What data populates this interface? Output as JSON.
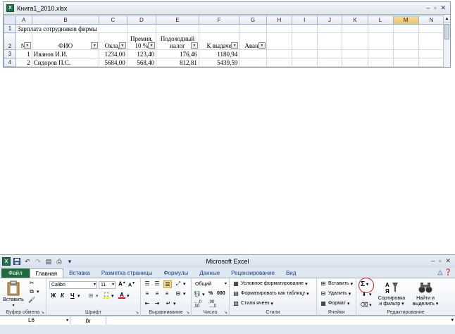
{
  "workbook": {
    "title": "Книга1_2010.xlsx",
    "window_controls": [
      "–",
      "▫",
      "✕"
    ],
    "columns": [
      "A",
      "B",
      "C",
      "D",
      "E",
      "F",
      "G",
      "H",
      "I",
      "J",
      "K",
      "L",
      "M",
      "N"
    ],
    "active_column": "M",
    "row_numbers": [
      "1",
      "2",
      "3",
      "4"
    ],
    "cells": {
      "r1_title": "Зарплата сотрудников фирмы",
      "h_num": "№",
      "h_fio": "ФИО",
      "h_oklad": "Оклад",
      "h_premia_1": "Премия,",
      "h_premia_2": "10 %",
      "h_nalog_1": "Подоходный",
      "h_nalog_2": "налог",
      "h_vydacha": "К выдаче",
      "h_avans": "Аванс",
      "rows": [
        {
          "n": "1",
          "fio": "Иванов И.И.",
          "oklad": "1234,00",
          "premia": "123,40",
          "nalog": "176,46",
          "vydacha": "1180,94"
        },
        {
          "n": "2",
          "fio": "Сидоров П.С.",
          "oklad": "5684,00",
          "premia": "568,40",
          "nalog": "812,81",
          "vydacha": "5439,59"
        }
      ]
    }
  },
  "app": {
    "title": "Microsoft Excel",
    "window_controls": [
      "–",
      "▫",
      "✕"
    ],
    "tabs": [
      "Файл",
      "Главная",
      "Вставка",
      "Разметка страницы",
      "Формулы",
      "Данные",
      "Рецензирование",
      "Вид"
    ],
    "active_tab": "Главная",
    "clipboard": {
      "paste_label": "Вставить",
      "group": "Буфер обмена"
    },
    "font": {
      "name": "Calibri",
      "size": "11",
      "bold": "Ж",
      "italic": "К",
      "underline": "Ч",
      "group": "Шрифт"
    },
    "alignment": {
      "group": "Выравнивание"
    },
    "number": {
      "format": "Общий",
      "percent": "%",
      "thousands": "000",
      "group": "Число"
    },
    "styles": {
      "conditional": "Условное форматирование",
      "as_table": "Форматировать как таблицу",
      "cell_styles": "Стили ячеек",
      "group": "Стили"
    },
    "cells_group": {
      "insert": "Вставить",
      "delete": "Удалить",
      "format": "Формат",
      "group": "Ячейки"
    },
    "editing": {
      "sort_1": "Сортировка",
      "sort_2": "и фильтр",
      "find_1": "Найти и",
      "find_2": "выделить",
      "group": "Редактирование"
    },
    "formula_bar": {
      "name_box": "L6",
      "fx": "fx",
      "content": ""
    }
  }
}
